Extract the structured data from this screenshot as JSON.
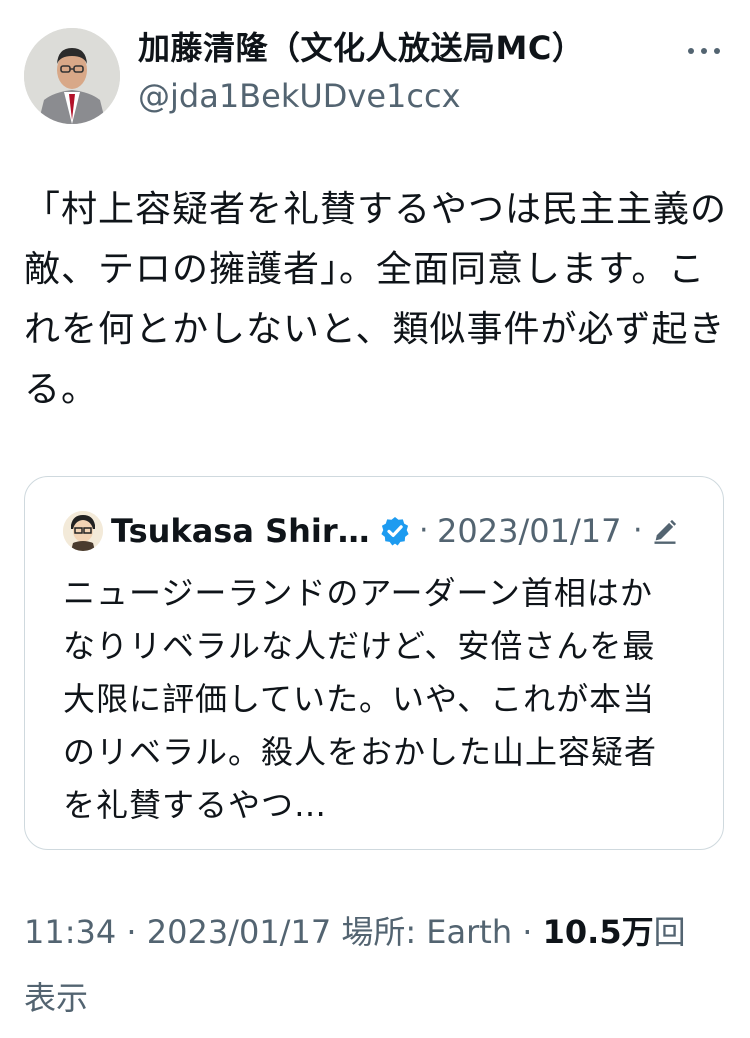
{
  "author": {
    "name": "加藤清隆（文化人放送局MC）",
    "handle": "@jda1BekUDve1ccx"
  },
  "more_icon": "more-horizontal-icon",
  "tweet": {
    "text": "「村上容疑者を礼賛するやつは民主主義の敵、テロの擁護者」。全面同意します。これを何とかしないと、類似事件が必ず起きる。"
  },
  "quote": {
    "author_name": "Tsukasa Shir…",
    "verified_icon": "verified-badge-icon",
    "separator": "·",
    "date": "2023/01/17",
    "edit_icon": "edit-pencil-icon",
    "text": "ニュージーランドのアーダーン首相はかなりリベラルな人だけど、安倍さんを最大限に評価していた。いや、これが本当のリベラル。殺人をおかした山上容疑者を礼賛するやつ…"
  },
  "meta": {
    "time": "11:34",
    "separator": " · ",
    "date": "2023/01/17",
    "location_label": "場所: Earth",
    "views_count": "10.5万",
    "views_suffix": "回",
    "views_line2": "表示"
  },
  "colors": {
    "text_primary": "#0f1419",
    "text_secondary": "#536471",
    "verified_blue": "#1d9bf0",
    "border": "#cfd9de"
  }
}
